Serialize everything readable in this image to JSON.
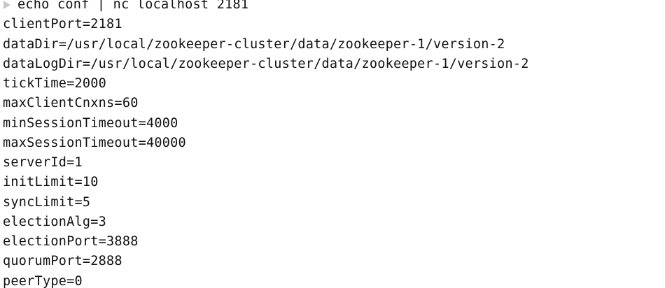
{
  "terminal": {
    "command": "echo conf | nc localhost 2181",
    "output": [
      "clientPort=2181",
      "dataDir=/usr/local/zookeeper-cluster/data/zookeeper-1/version-2",
      "dataLogDir=/usr/local/zookeeper-cluster/data/zookeeper-1/version-2",
      "tickTime=2000",
      "maxClientCnxns=60",
      "minSessionTimeout=4000",
      "maxSessionTimeout=40000",
      "serverId=1",
      "initLimit=10",
      "syncLimit=5",
      "electionAlg=3",
      "electionPort=3888",
      "quorumPort=2888",
      "peerType=0"
    ]
  },
  "colors": {
    "background": "#ffffff",
    "text": "#111111",
    "prompt": "#c8c8c8"
  },
  "icons": {
    "prompt": "triangle-right-icon"
  }
}
